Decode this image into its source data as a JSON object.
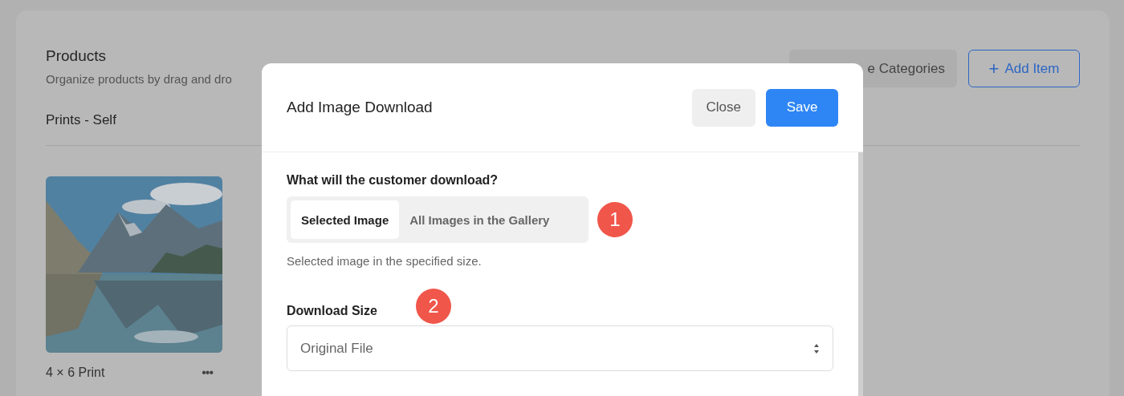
{
  "page": {
    "title": "Products",
    "subtitle": "Organize products by drag and dro",
    "buttons": [
      {
        "label": "e Categories",
        "kind": "secondary"
      },
      {
        "label": "Add Item",
        "icon": "+",
        "kind": "outline"
      }
    ],
    "section": "Prints - Self",
    "products": [
      {
        "kind": "picture",
        "name": "4 × 6 Print",
        "menu": "•••"
      }
    ]
  },
  "dialog": {
    "title": "Add Image Download",
    "buttons": [
      {
        "label": "Close",
        "kind": "secondary"
      },
      {
        "label": "Save",
        "kind": "primary"
      }
    ],
    "question": "What will the customer download?",
    "options": [
      {
        "label": "Selected Image",
        "selected": true
      },
      {
        "label": "All Images in the Gallery",
        "selected": false
      }
    ],
    "help": "Selected image in the specified size.",
    "size_label": "Download Size",
    "size_value": "Original File",
    "markers": [
      "1",
      "2"
    ]
  }
}
